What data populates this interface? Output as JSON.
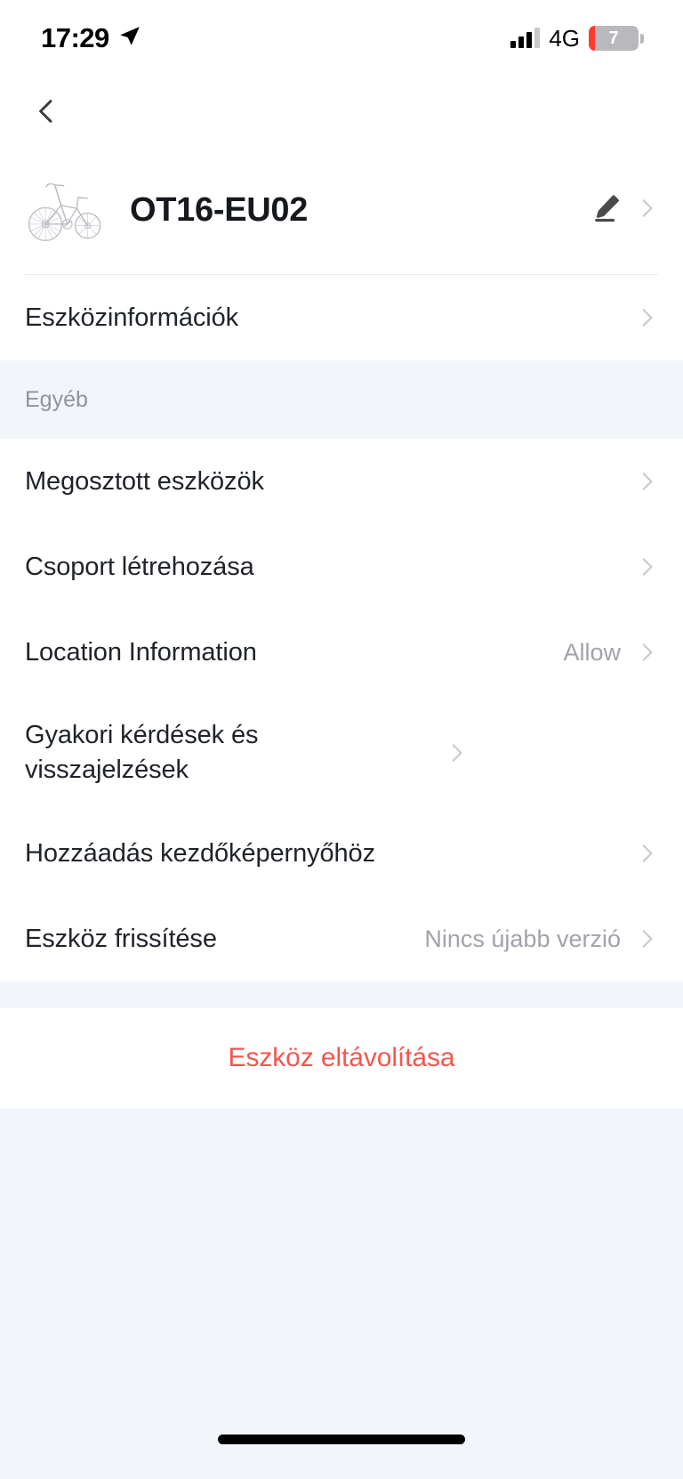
{
  "status_bar": {
    "time": "17:29",
    "location_icon": "location-arrow-icon",
    "network": "4G",
    "battery_percent": "7",
    "signal_icon": "signal-bars-icon"
  },
  "nav": {
    "back_icon": "chevron-left-icon"
  },
  "device": {
    "name": "OT16-EU02",
    "thumbnail_icon": "bicycle-icon",
    "edit_icon": "pencil-edit-icon",
    "chevron_icon": "chevron-right-icon"
  },
  "info_row": {
    "label": "Eszközinformációk",
    "chevron_icon": "chevron-right-icon"
  },
  "section": {
    "title": "Egyéb"
  },
  "rows": [
    {
      "label": "Megosztott eszközök",
      "value": "",
      "chevron_icon": "chevron-right-icon"
    },
    {
      "label": "Csoport létrehozása",
      "value": "",
      "chevron_icon": "chevron-right-icon"
    },
    {
      "label": "Location Information",
      "value": "Allow",
      "chevron_icon": "chevron-right-icon"
    },
    {
      "label": "Gyakori kérdések és visszajelzések",
      "value": "",
      "chevron_icon": "chevron-right-icon"
    },
    {
      "label": "Hozzáadás kezdőképernyőhöz",
      "value": "",
      "chevron_icon": "chevron-right-icon"
    },
    {
      "label": "Eszköz frissítése",
      "value": "Nincs újabb verzió",
      "chevron_icon": "chevron-right-icon"
    }
  ],
  "remove": {
    "label": "Eszköz eltávolítása"
  },
  "colors": {
    "background": "#f2f5fa",
    "card": "#ffffff",
    "primary_text": "#20242a",
    "secondary_text": "#a0a3aa",
    "section_text": "#8f949d",
    "danger": "#f4564e",
    "chevron": "#c9cacf",
    "battery_low": "#ff3b30"
  }
}
